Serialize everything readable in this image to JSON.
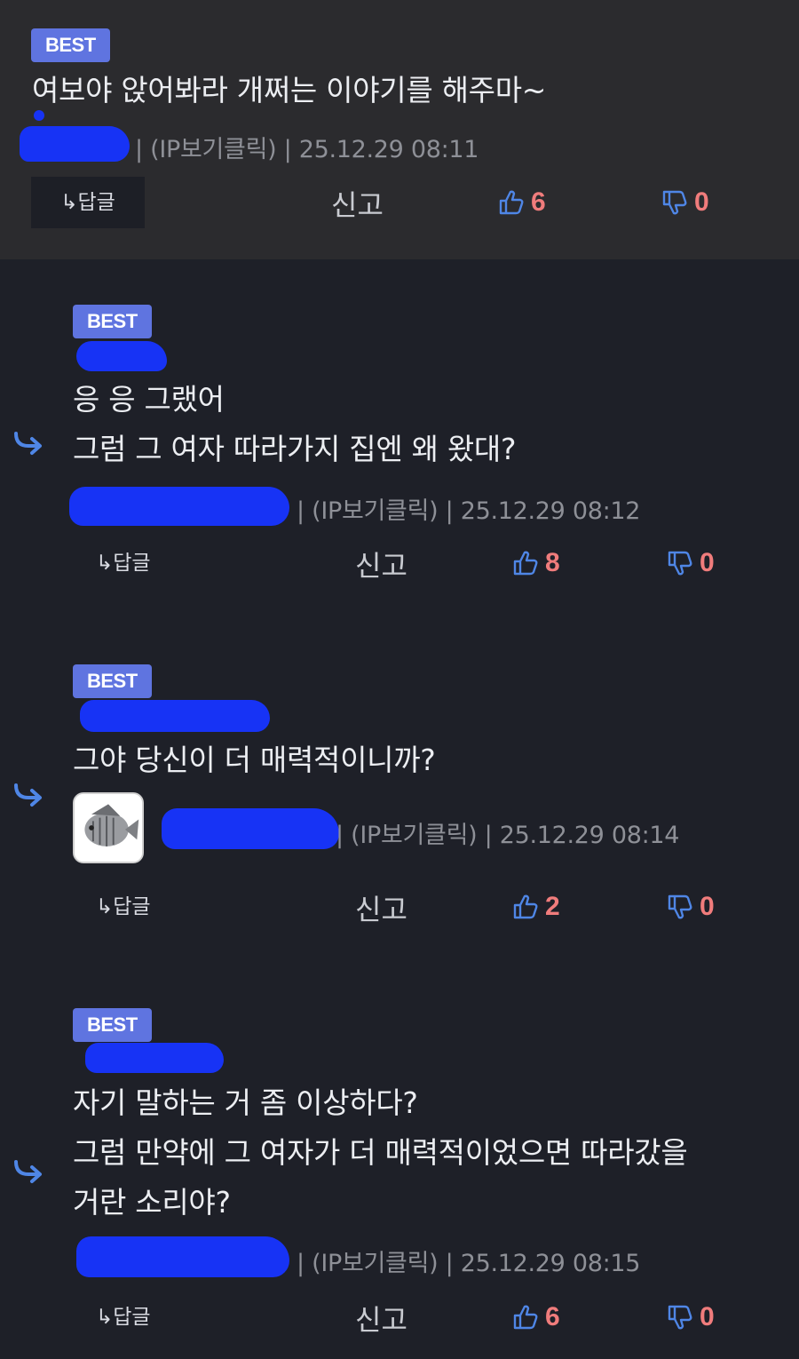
{
  "comments": [
    {
      "badge": "BEST",
      "lines": [
        "여보야 앉어봐라 개쩌는 이야기를 해주마~"
      ],
      "meta": "| (IP보기클릭) | 25.12.29 08:11",
      "reply_label": "↳답글",
      "report_label": "신고",
      "likes": "6",
      "dislikes": "0"
    },
    {
      "badge": "BEST",
      "lines": [
        "응 응 그랬어",
        "그럼 그 여자 따라가지 집엔 왜 왔대?"
      ],
      "meta": "| (IP보기클릭) | 25.12.29 08:12",
      "reply_label": "↳답글",
      "report_label": "신고",
      "likes": "8",
      "dislikes": "0"
    },
    {
      "badge": "BEST",
      "lines": [
        "그야 당신이 더 매력적이니까?"
      ],
      "meta": "| (IP보기클릭) | 25.12.29 08:14",
      "reply_label": "↳답글",
      "report_label": "신고",
      "likes": "2",
      "dislikes": "0"
    },
    {
      "badge": "BEST",
      "lines": [
        "자기 말하는 거 좀 이상하다?",
        "그럼 만약에 그 여자가 더 매력적이었으면 따라갔을",
        "거란 소리야?"
      ],
      "meta": "| (IP보기클릭) | 25.12.29 08:15",
      "reply_label": "↳답글",
      "report_label": "신고",
      "likes": "6",
      "dislikes": "0"
    }
  ],
  "icons": {
    "like": "thumbs-up-icon",
    "dislike": "thumbs-down-icon",
    "reply_arrow": "reply-arrow-icon",
    "avatar": "fish-avatar"
  },
  "colors": {
    "badge": "#5f74e0",
    "vote_count": "#f07c7c",
    "icon_blue": "#4f86e6",
    "redaction": "#1733f5"
  }
}
